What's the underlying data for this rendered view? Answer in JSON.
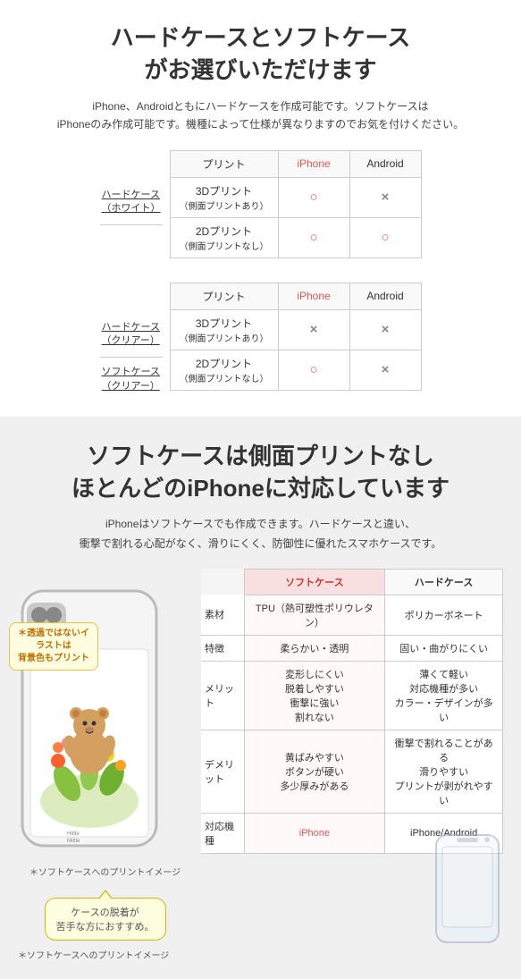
{
  "section1": {
    "title": "ハードケースとソフトケース\nがお選びいただけます",
    "desc": "iPhone、Androidともにハードケースを作成可能です。ソフトケースは\niPhoneのみ作成可能です。機種によって仕様が異なりますのでお気を付けください。",
    "table1": {
      "header": [
        "プリント",
        "iPhone",
        "Android"
      ],
      "left_label_main": "ハードケース",
      "left_label_sub": "（ホワイト）",
      "rows": [
        {
          "label": "3Dプリント\n（側面プリントあり）",
          "iphone": "○",
          "android": "×"
        },
        {
          "label": "2Dプリント\n（側面プリントなし）",
          "iphone": "○",
          "android": "○"
        }
      ]
    },
    "table2": {
      "header": [
        "プリント",
        "iPhone",
        "Android"
      ],
      "left_labels": [
        {
          "main": "ハードケース",
          "sub": "（クリアー）"
        },
        {
          "main": "ソフトケース",
          "sub": "（クリアー）"
        }
      ],
      "rows": [
        {
          "label": "3Dプリント\n（側面プリントあり）",
          "iphone": "×",
          "android": "×"
        },
        {
          "label": "2Dプリント\n（側面プリントなし）",
          "iphone": "○",
          "android": "×"
        }
      ]
    }
  },
  "section2": {
    "title": "ソフトケースは側面プリントなし\nほとんどのiPhoneに対応しています",
    "desc": "iPhoneはソフトケースでも作成できます。ハードケースと違い、\n衝撃で割れる心配がなく、滑りにくく、防御性に優れたスマホケースです。",
    "note_bubble": "＊透過ではないイラストは\n背景色もプリント",
    "phone_caption": "＊ソフトケースへのプリントイメージ",
    "balloon": "ケースの脱着が\n苦手な方におすすめ。",
    "compare_table": {
      "col_soft": "ソフトケース",
      "col_hard": "ハードケース",
      "rows": [
        {
          "label": "素材",
          "soft": "TPU（熱可塑性ポリウレタン）",
          "hard": "ポリカーボネート"
        },
        {
          "label": "特徴",
          "soft": "柔らかい・透明",
          "hard": "固い・曲がりにくい"
        },
        {
          "label": "メリット",
          "soft": "変形しにくい\n脱着しやすい\n衝撃に強い\n割れない",
          "hard": "薄くて軽い\n対応機種が多い\nカラー・デザインが多い"
        },
        {
          "label": "デメリット",
          "soft": "黄ばみやすい\nボタンが硬い\n多少厚みがある",
          "hard": "衝撃で割れることがある\n滑りやすい\nプリントが剥がれやすい"
        },
        {
          "label": "対応機種",
          "soft": "iPhone",
          "hard": "iPhone/Android"
        }
      ]
    }
  }
}
